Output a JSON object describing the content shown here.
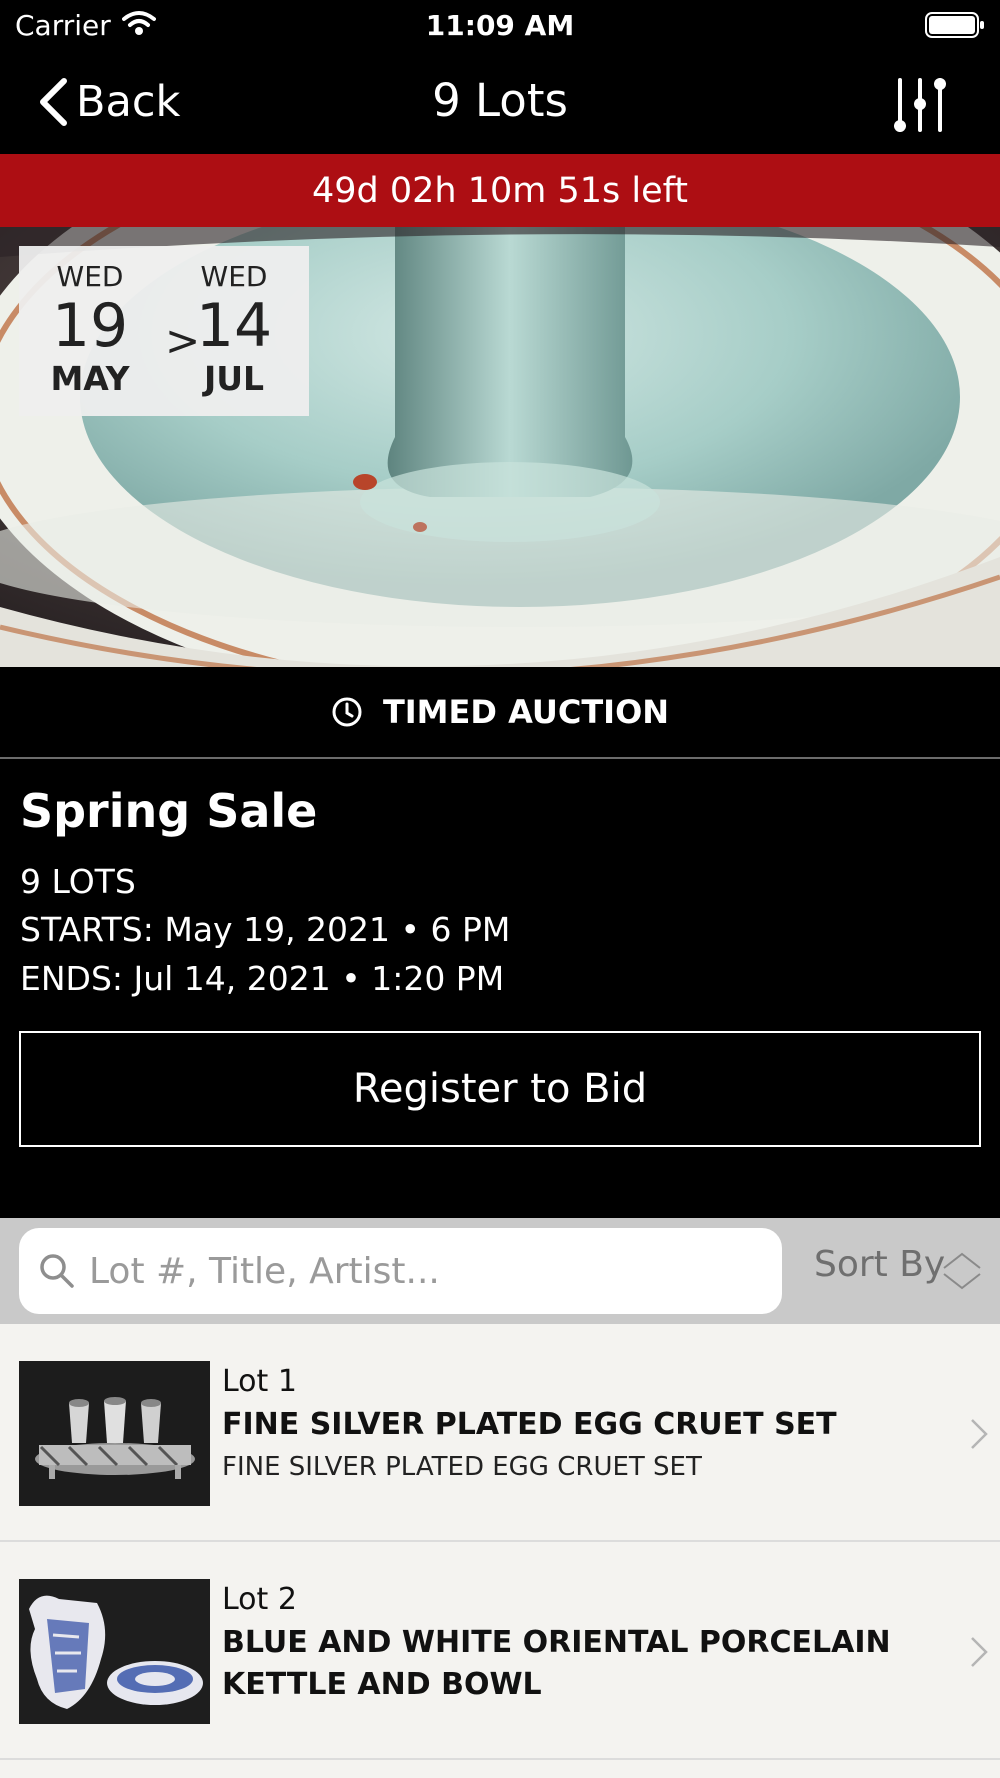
{
  "status_bar": {
    "carrier": "Carrier",
    "time": "11:09 AM"
  },
  "nav": {
    "back_label": "Back",
    "title": "9 Lots",
    "filter_icon": "sliders-icon"
  },
  "countdown": {
    "text": "49d 02h 10m 51s left",
    "color": "#ad0e13"
  },
  "date_range": {
    "start": {
      "dow": "WED",
      "day": "19",
      "month": "MAY"
    },
    "separator": ">",
    "end": {
      "dow": "WED",
      "day": "14",
      "month": "JUL"
    }
  },
  "auction_type": {
    "icon": "clock-icon",
    "label": "TIMED AUCTION"
  },
  "sale": {
    "title": "Spring Sale",
    "lots": "9 LOTS",
    "starts": "STARTS: May 19, 2021 • 6 PM",
    "ends": "ENDS: Jul 14, 2021 • 1:20 PM"
  },
  "register_label": "Register to Bid",
  "search": {
    "placeholder": "Lot #, Title, Artist...",
    "value": ""
  },
  "sort_label": "Sort By",
  "lots": [
    {
      "number": "Lot 1",
      "title": "FINE SILVER PLATED EGG CRUET SET",
      "subtitle": "FINE SILVER PLATED EGG CRUET SET"
    },
    {
      "number": "Lot 2",
      "title": "BLUE AND WHITE ORIENTAL PORCELAIN KETTLE AND BOWL",
      "subtitle": ""
    }
  ]
}
